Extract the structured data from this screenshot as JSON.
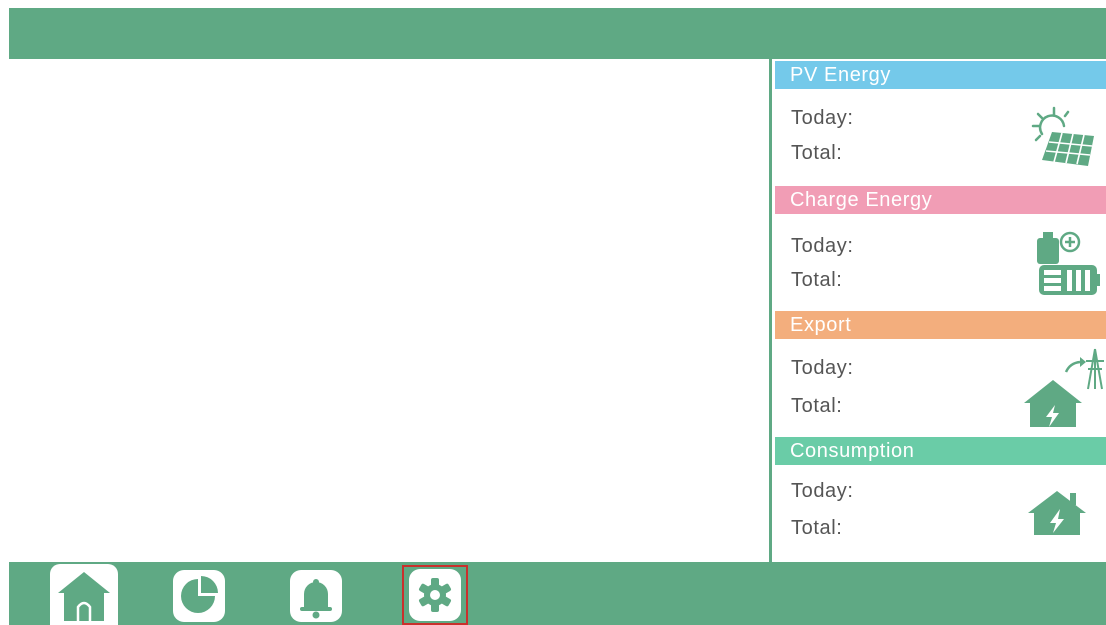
{
  "colors": {
    "theme_green": "#5fa984",
    "pv_header": "#74c9ea",
    "charge_header": "#f19db5",
    "export_header": "#f3ae7d",
    "consumption_header": "#6acca7",
    "selected_outline": "#c9302c"
  },
  "panel": {
    "sections": [
      {
        "title": "PV Energy",
        "today_label": "Today:",
        "total_label": "Total:",
        "icon": "solar-panel-icon"
      },
      {
        "title": "Charge Energy",
        "today_label": "Today:",
        "total_label": "Total:",
        "icon": "battery-charge-icon"
      },
      {
        "title": "Export",
        "today_label": "Today:",
        "total_label": "Total:",
        "icon": "house-export-grid-icon"
      },
      {
        "title": "Consumption",
        "today_label": "Today:",
        "total_label": "Total:",
        "icon": "house-consumption-icon"
      }
    ]
  },
  "nav": {
    "items": [
      {
        "icon": "home-icon",
        "state": "active"
      },
      {
        "icon": "pie-chart-icon",
        "state": "normal"
      },
      {
        "icon": "bell-icon",
        "state": "normal"
      },
      {
        "icon": "gear-icon",
        "state": "selected"
      }
    ]
  }
}
